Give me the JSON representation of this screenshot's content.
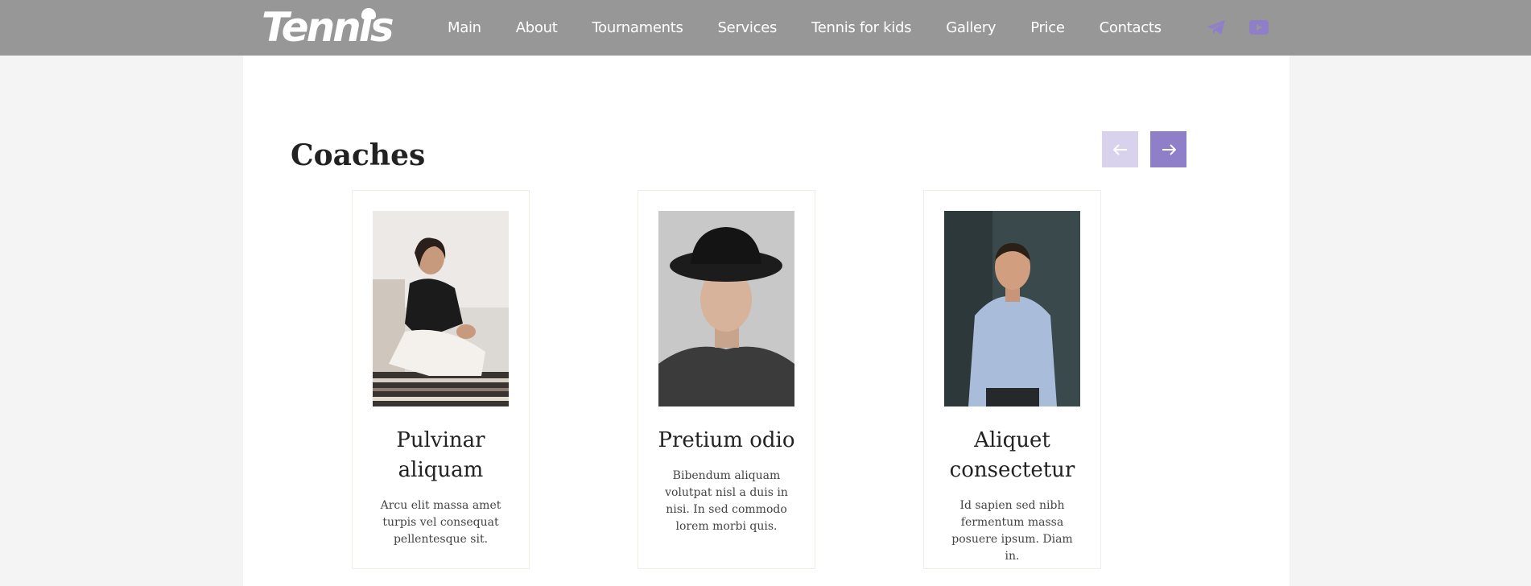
{
  "brand": {
    "logo_text": "Tennis"
  },
  "nav": {
    "items": [
      "Main",
      "About",
      "Tournaments",
      "Services",
      "Tennis for kids",
      "Gallery",
      "Price",
      "Contacts"
    ]
  },
  "social": {
    "telegram_icon": "telegram-icon",
    "youtube_icon": "youtube-icon",
    "color": "#8f7fc8"
  },
  "section": {
    "title": "Coaches"
  },
  "carousel": {
    "prev_icon": "arrow-left-icon",
    "next_icon": "arrow-right-icon"
  },
  "coaches": [
    {
      "name": "Pulvinar aliquam",
      "text": "Arcu elit massa amet turpis vel consequat pellentesque sit."
    },
    {
      "name": "Pretium odio",
      "text": "Bibendum aliquam volutpat nisl a duis in nisi. In sed commodo lorem morbi quis."
    },
    {
      "name": "Aliquet consectetur",
      "text": "Id sapien sed nibh fermentum massa posuere ipsum. Diam in."
    }
  ],
  "colors": {
    "header_bg": "#979797",
    "accent": "#8f7fc8",
    "accent_light": "#d8d2ec"
  }
}
